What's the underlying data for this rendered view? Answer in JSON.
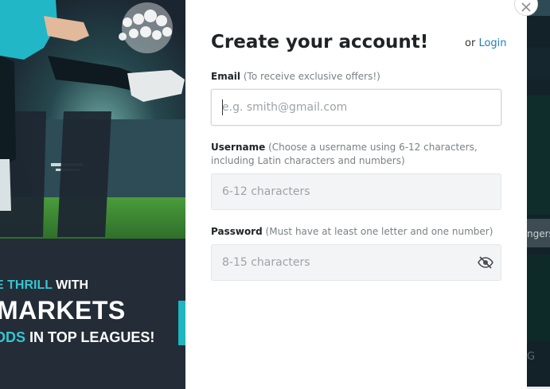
{
  "promo": {
    "line1_prefix": "E THRILL",
    "line1_suffix": " WITH",
    "line2": "MARKETS",
    "line3_prefix": "DDS",
    "line3_suffix": " IN TOP LEAGUES!",
    "accent_color": "#34c5d1"
  },
  "backdrop": {
    "partial_label": "ngers",
    "partial_letter": "G"
  },
  "modal": {
    "title": "Create your account!",
    "login_prefix": "or",
    "login_link": "Login",
    "close_icon": "close-icon",
    "email": {
      "label": "Email",
      "hint": "(To receive exclusive offers!)",
      "placeholder": "e.g. smith@gmail.com",
      "value": ""
    },
    "username": {
      "label": "Username",
      "hint": "(Choose a username using 6-12 characters, including Latin characters and numbers)",
      "placeholder": "6-12 characters",
      "value": ""
    },
    "password": {
      "label": "Password",
      "hint": "(Must have at least one letter and one number)",
      "placeholder": "8-15 characters",
      "value": "",
      "toggle_icon": "eye-slash-icon"
    }
  },
  "colors": {
    "link": "#1f7fbf",
    "accent": "#34c5d1",
    "promo_bg": "#232c37"
  }
}
